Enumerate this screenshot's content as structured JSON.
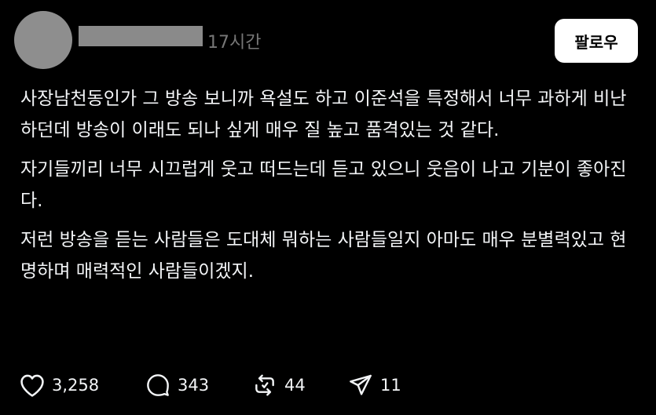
{
  "post": {
    "username": "_ _ _ _ _ _",
    "timestamp": "17시간",
    "follow_label": "팔로우",
    "paragraphs": [
      "사장남천동인가 그 방송 보니까 욕설도 하고 이준석을 특정해서 너무 과하게 비난하던데 방송이 이래도 되나 싶게 매우 질 높고 품격있는 것 같다.",
      "자기들끼리 너무 시끄럽게 웃고 떠드는데 듣고 있으니 웃음이 나고 기분이 좋아진다.",
      "저런 방송을 듣는 사람들은 도대체 뭐하는 사람들일지 아마도 매우 분별력있고 현명하며 매력적인 사람들이겠지."
    ],
    "actions": {
      "likes": "3,258",
      "comments": "343",
      "reposts": "44",
      "shares": "11"
    }
  },
  "icons": {
    "like": "heart-icon",
    "comment": "comment-bubble-icon",
    "repost": "repost-icon",
    "share": "send-icon"
  },
  "colors": {
    "background": "#000000",
    "text": "#f3f5f7",
    "muted": "#777777",
    "avatar": "#8e8e8e",
    "button_bg": "#ffffff"
  }
}
